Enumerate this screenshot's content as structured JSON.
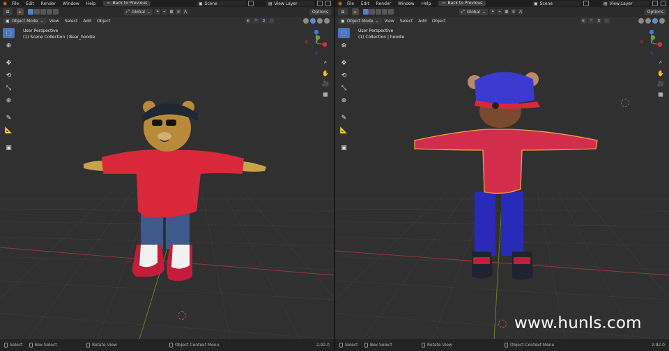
{
  "panes": [
    {
      "id": "left",
      "menus": [
        "File",
        "Edit",
        "Render",
        "Window",
        "Help"
      ],
      "back_button": "Back to Previous",
      "scene_name": "Scene",
      "view_layer": "View Layer",
      "orientation": "Global",
      "options_label": "Options",
      "mode": "Object Mode",
      "viewport_menus": [
        "View",
        "Select",
        "Add",
        "Object"
      ],
      "perspective": "User Perspective",
      "collection_info": "(1) Scene Collection | Bear_hoodie",
      "status": {
        "select": "Select",
        "box_select": "Box Select",
        "rotate_view": "Rotate View",
        "context_menu": "Object Context Menu",
        "version": "2.92.0"
      }
    },
    {
      "id": "right",
      "menus": [
        "File",
        "Edit",
        "Render",
        "Window",
        "Help"
      ],
      "back_button": "Back to Previous",
      "scene_name": "Scene",
      "view_layer": "View Layer",
      "orientation": "Global",
      "options_label": "Options",
      "mode": "Object Mode",
      "viewport_menus": [
        "View",
        "Select",
        "Add",
        "Object"
      ],
      "perspective": "User Perspective",
      "collection_info": "(1) Collection | hoodie",
      "status": {
        "select": "Select",
        "box_select": "Box Select",
        "rotate_view": "Rotate View",
        "context_menu": "Object Context Menu",
        "version": "2.92.0"
      }
    }
  ],
  "watermark": "www.hunls.com",
  "colors": {
    "accent": "#4b73b8",
    "viewport_bg": "#303030",
    "hoodie_red": "#d8283a",
    "jeans_blue": "#3d5a8a",
    "cap_blue": "#3a3ad0",
    "selection_outline": "#f3a13a"
  },
  "icons": {
    "toolbar": [
      "select-box-icon",
      "cursor-icon",
      "move-icon",
      "rotate-icon",
      "scale-icon",
      "transform-icon",
      "annotate-icon",
      "measure-icon",
      "add-cube-icon"
    ],
    "nav": [
      "zoom-icon",
      "hand-pan-icon",
      "camera-icon",
      "grid-ortho-icon"
    ]
  }
}
